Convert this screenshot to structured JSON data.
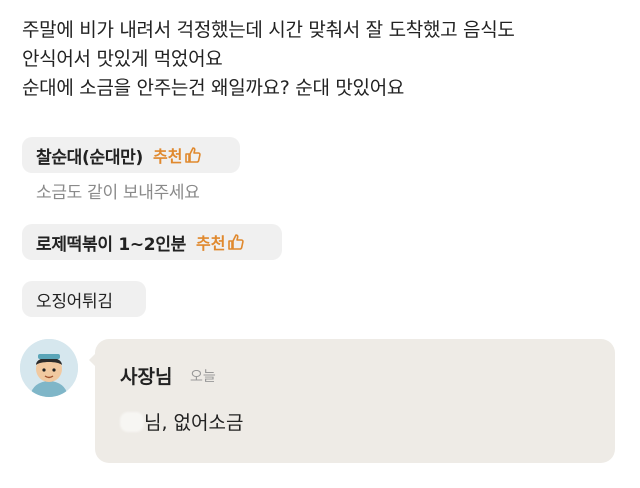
{
  "review": {
    "lines": [
      "주말에 비가 내려서 걱정했는데 시간 맞춰서 잘 도착했고 음식도",
      "안식어서 맛있게 먹었어요",
      "순대에 소금을 안주는건 왜일까요? 순대 맛있어요"
    ]
  },
  "menu_items": [
    {
      "name": "찰순대(순대만)",
      "recommend_label": "추천",
      "icon": "thumbs-up-icon"
    },
    {
      "name": "로제떡볶이 1~2인분",
      "recommend_label": "추천",
      "icon": "thumbs-up-icon"
    },
    {
      "name": "오징어튀김"
    }
  ],
  "option_note": "소금도 같이 보내주세요",
  "reply": {
    "author": "사장님",
    "date": "오늘",
    "content_visible": "님, 없어소금",
    "avatar_icon": "owner-avatar-icon"
  },
  "colors": {
    "recommend": "#e0892e",
    "chip_bg": "#f0f0f0",
    "reply_bg": "#eeebe6",
    "muted_text": "#8a8a8a"
  }
}
